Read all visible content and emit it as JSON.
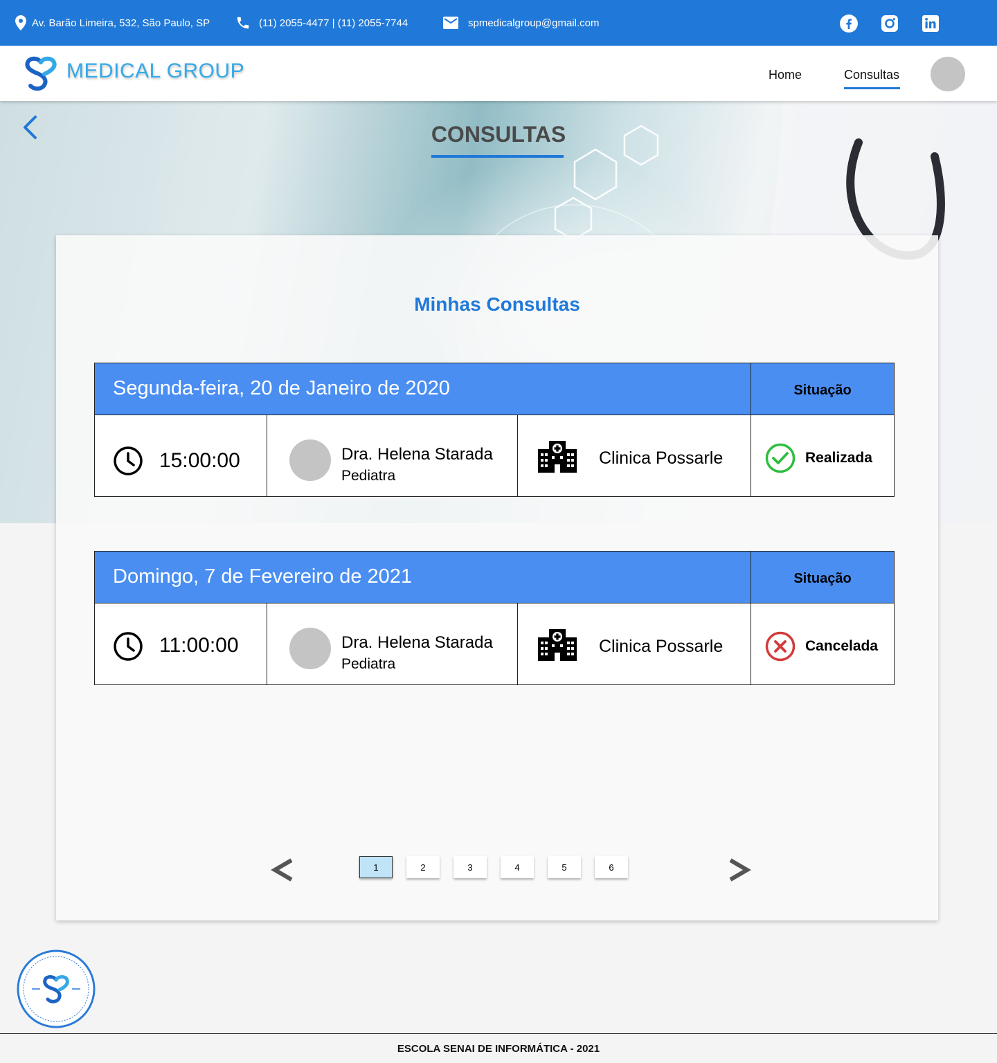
{
  "topbar": {
    "address": "Av. Barão Limeira, 532, São Paulo, SP",
    "phones": "(11) 2055-4477 | (11) 2055-7744",
    "email": "spmedicalgroup@gmail.com",
    "social": [
      "facebook-icon",
      "instagram-icon",
      "linkedin-icon"
    ]
  },
  "nav": {
    "brand": "MEDICAL GROUP",
    "links": [
      "Home",
      "Consultas"
    ],
    "active": "Consultas"
  },
  "hero": {
    "title": "CONSULTAS"
  },
  "main": {
    "title": "Minhas Consultas",
    "situation_label": "Situação",
    "appointments": [
      {
        "date": "Segunda-feira, 20 de Janeiro de 2020",
        "time": "15:00:00",
        "doctor": "Dra. Helena Starada",
        "specialty": "Pediatra",
        "clinic": "Clinica Possarle",
        "status": "Realizada",
        "status_icon": "check-circle-icon",
        "status_color": "#2ebd3f"
      },
      {
        "date": "Domingo, 7 de Fevereiro de 2021",
        "time": "11:00:00",
        "doctor": "Dra. Helena Starada",
        "specialty": "Pediatra",
        "clinic": "Clinica Possarle",
        "status": "Cancelada",
        "status_icon": "x-circle-icon",
        "status_color": "#d43a3a"
      }
    ]
  },
  "pagination": {
    "pages": [
      "1",
      "2",
      "3",
      "4",
      "5",
      "6"
    ],
    "current": "1"
  },
  "footer": {
    "text": "ESCOLA SENAI DE INFORMÁTICA - 2021"
  },
  "colors": {
    "primary": "#2079d8",
    "header": "#4a8ef2",
    "brand_text": "#35a9e8"
  }
}
